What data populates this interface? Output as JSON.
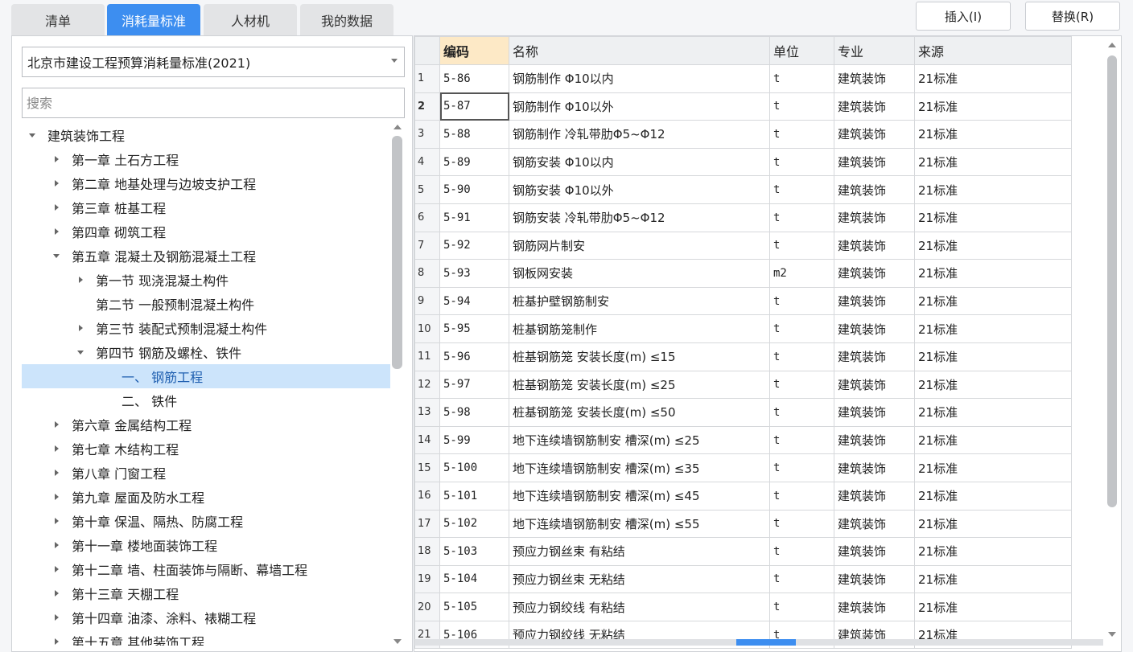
{
  "tabs": [
    {
      "label": "清单",
      "active": false
    },
    {
      "label": "消耗量标准",
      "active": true
    },
    {
      "label": "人材机",
      "active": false
    },
    {
      "label": "我的数据",
      "active": false
    }
  ],
  "actions": {
    "insert": "插入(I)",
    "replace": "替换(R)"
  },
  "left": {
    "standard": "北京市建设工程预算消耗量标准(2021)",
    "search_placeholder": "搜索",
    "tree": [
      {
        "label": "建筑装饰工程",
        "level": 0,
        "caret": "down"
      },
      {
        "label": "第一章 土石方工程",
        "level": 1,
        "caret": "right"
      },
      {
        "label": "第二章 地基处理与边坡支护工程",
        "level": 1,
        "caret": "right"
      },
      {
        "label": "第三章 桩基工程",
        "level": 1,
        "caret": "right"
      },
      {
        "label": "第四章 砌筑工程",
        "level": 1,
        "caret": "right"
      },
      {
        "label": "第五章 混凝土及钢筋混凝土工程",
        "level": 1,
        "caret": "down"
      },
      {
        "label": "第一节 现浇混凝土构件",
        "level": 2,
        "caret": "right"
      },
      {
        "label": "第二节 一般预制混凝土构件",
        "level": 2,
        "caret": "none"
      },
      {
        "label": "第三节 装配式预制混凝土构件",
        "level": 2,
        "caret": "right"
      },
      {
        "label": "第四节 钢筋及螺栓、铁件",
        "level": 2,
        "caret": "down"
      },
      {
        "label": "一、 钢筋工程",
        "level": 3,
        "caret": "none",
        "selected": true
      },
      {
        "label": "二、 铁件",
        "level": 3,
        "caret": "none"
      },
      {
        "label": "第六章 金属结构工程",
        "level": 1,
        "caret": "right"
      },
      {
        "label": "第七章 木结构工程",
        "level": 1,
        "caret": "right"
      },
      {
        "label": "第八章 门窗工程",
        "level": 1,
        "caret": "right"
      },
      {
        "label": "第九章 屋面及防水工程",
        "level": 1,
        "caret": "right"
      },
      {
        "label": "第十章 保温、隔热、防腐工程",
        "level": 1,
        "caret": "right"
      },
      {
        "label": "第十一章 楼地面装饰工程",
        "level": 1,
        "caret": "right"
      },
      {
        "label": "第十二章 墙、柱面装饰与隔断、幕墙工程",
        "level": 1,
        "caret": "right"
      },
      {
        "label": "第十三章 天棚工程",
        "level": 1,
        "caret": "right"
      },
      {
        "label": "第十四章 油漆、涂料、裱糊工程",
        "level": 1,
        "caret": "right"
      },
      {
        "label": "第十五章 其他装饰工程",
        "level": 1,
        "caret": "right"
      }
    ]
  },
  "grid": {
    "columns": [
      "编码",
      "名称",
      "单位",
      "专业",
      "来源"
    ],
    "current_row": 2,
    "rows": [
      {
        "n": "1",
        "code": "5-86",
        "name": "钢筋制作 Φ10以内",
        "unit": "t",
        "major": "建筑装饰",
        "source": "21标准"
      },
      {
        "n": "2",
        "code": "5-87",
        "name": "钢筋制作 Φ10以外",
        "unit": "t",
        "major": "建筑装饰",
        "source": "21标准"
      },
      {
        "n": "3",
        "code": "5-88",
        "name": "钢筋制作 冷轧带肋Φ5~Φ12",
        "unit": "t",
        "major": "建筑装饰",
        "source": "21标准"
      },
      {
        "n": "4",
        "code": "5-89",
        "name": "钢筋安装 Φ10以内",
        "unit": "t",
        "major": "建筑装饰",
        "source": "21标准"
      },
      {
        "n": "5",
        "code": "5-90",
        "name": "钢筋安装 Φ10以外",
        "unit": "t",
        "major": "建筑装饰",
        "source": "21标准"
      },
      {
        "n": "6",
        "code": "5-91",
        "name": "钢筋安装 冷轧带肋Φ5~Φ12",
        "unit": "t",
        "major": "建筑装饰",
        "source": "21标准"
      },
      {
        "n": "7",
        "code": "5-92",
        "name": "钢筋网片制安",
        "unit": "t",
        "major": "建筑装饰",
        "source": "21标准"
      },
      {
        "n": "8",
        "code": "5-93",
        "name": "钢板网安装",
        "unit": "m2",
        "major": "建筑装饰",
        "source": "21标准"
      },
      {
        "n": "9",
        "code": "5-94",
        "name": "桩基护壁钢筋制安",
        "unit": "t",
        "major": "建筑装饰",
        "source": "21标准"
      },
      {
        "n": "10",
        "code": "5-95",
        "name": "桩基钢筋笼制作",
        "unit": "t",
        "major": "建筑装饰",
        "source": "21标准"
      },
      {
        "n": "11",
        "code": "5-96",
        "name": "桩基钢筋笼 安装长度(m) ≤15",
        "unit": "t",
        "major": "建筑装饰",
        "source": "21标准"
      },
      {
        "n": "12",
        "code": "5-97",
        "name": "桩基钢筋笼 安装长度(m) ≤25",
        "unit": "t",
        "major": "建筑装饰",
        "source": "21标准"
      },
      {
        "n": "13",
        "code": "5-98",
        "name": "桩基钢筋笼 安装长度(m) ≤50",
        "unit": "t",
        "major": "建筑装饰",
        "source": "21标准"
      },
      {
        "n": "14",
        "code": "5-99",
        "name": "地下连续墙钢筋制安 槽深(m) ≤25",
        "unit": "t",
        "major": "建筑装饰",
        "source": "21标准"
      },
      {
        "n": "15",
        "code": "5-100",
        "name": "地下连续墙钢筋制安 槽深(m) ≤35",
        "unit": "t",
        "major": "建筑装饰",
        "source": "21标准"
      },
      {
        "n": "16",
        "code": "5-101",
        "name": "地下连续墙钢筋制安 槽深(m) ≤45",
        "unit": "t",
        "major": "建筑装饰",
        "source": "21标准"
      },
      {
        "n": "17",
        "code": "5-102",
        "name": "地下连续墙钢筋制安 槽深(m) ≤55",
        "unit": "t",
        "major": "建筑装饰",
        "source": "21标准"
      },
      {
        "n": "18",
        "code": "5-103",
        "name": "预应力钢丝束 有粘结",
        "unit": "t",
        "major": "建筑装饰",
        "source": "21标准"
      },
      {
        "n": "19",
        "code": "5-104",
        "name": "预应力钢丝束 无粘结",
        "unit": "t",
        "major": "建筑装饰",
        "source": "21标准"
      },
      {
        "n": "20",
        "code": "5-105",
        "name": "预应力钢绞线 有粘结",
        "unit": "t",
        "major": "建筑装饰",
        "source": "21标准"
      },
      {
        "n": "21",
        "code": "5-106",
        "name": "预应力钢绞线 无粘结",
        "unit": "t",
        "major": "建筑装饰",
        "source": "21标准"
      }
    ]
  },
  "colors": {
    "accent": "#3d8ef0",
    "selected_row": "#cce4fb",
    "code_header": "#fde9c6"
  }
}
